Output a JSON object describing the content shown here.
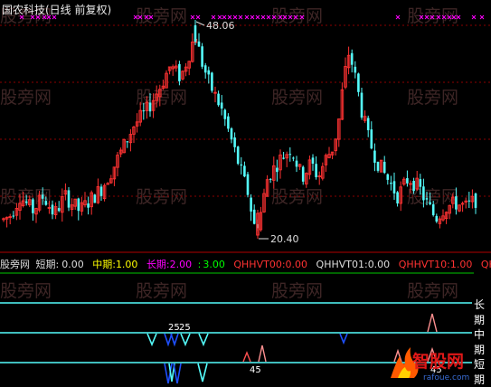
{
  "chart_title": "国农科技(日线 前复权)",
  "price_high_label": "48.06",
  "price_low_label": "20.40",
  "indicator_header": {
    "name": "股旁网",
    "short_label": "短期:",
    "short_value": "0.00",
    "mid_label": "中期:",
    "mid_value": "1.00",
    "long_label": "长期:",
    "long_value": "2.00",
    "extra_label": ":",
    "extra_value": "3.00",
    "q00_label": "QHHVT00:",
    "q00_value": "0.00",
    "q01_label": "QHHVT01:",
    "q01_value": "0.00",
    "q10_label": "QHHVT10:",
    "q10_value": "1.00",
    "trailing": "QH"
  },
  "lines": {
    "long_label": "长期",
    "mid_label": "中期",
    "short_label": "短期"
  },
  "signals": {
    "mid_text_1": "25",
    "mid_text_2": "25",
    "short_text_1": "45",
    "short_text_2": "45"
  },
  "watermark_text": "股旁网",
  "logo_text": "智股网",
  "logo_url": "rafoue.com",
  "colors": {
    "up": "#ff3232",
    "down": "#54fcfc",
    "magenta": "#ff00ff",
    "short_line": "#54fcfc",
    "mid_line": "#54fcfc",
    "long_line": "#54fcfc",
    "grid": "#8b0000",
    "pink": "#ff9090",
    "blue": "#1e50ff"
  }
}
